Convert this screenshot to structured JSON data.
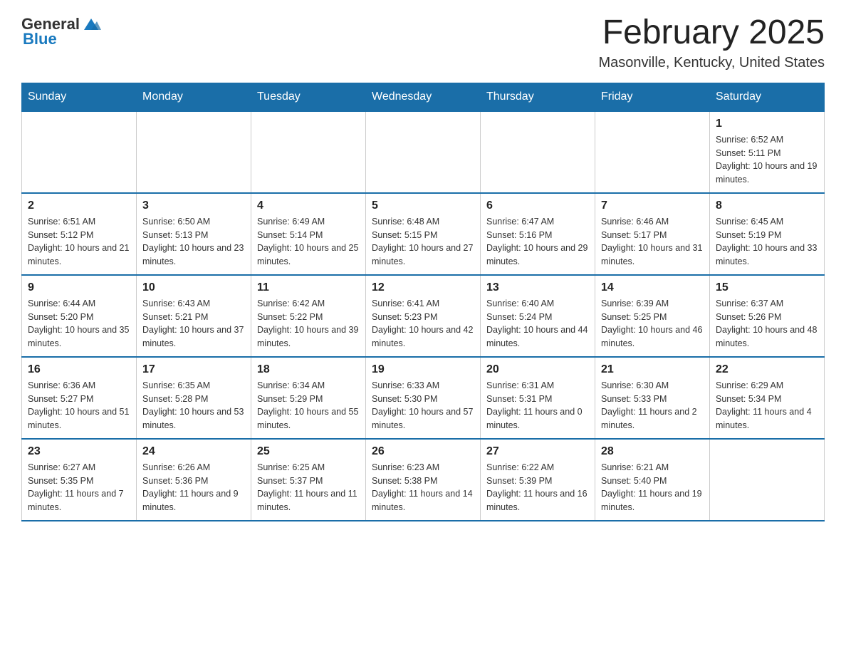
{
  "header": {
    "logo_general": "General",
    "logo_blue": "Blue",
    "title": "February 2025",
    "location": "Masonville, Kentucky, United States"
  },
  "weekdays": [
    "Sunday",
    "Monday",
    "Tuesday",
    "Wednesday",
    "Thursday",
    "Friday",
    "Saturday"
  ],
  "weeks": [
    [
      {
        "day": "",
        "info": ""
      },
      {
        "day": "",
        "info": ""
      },
      {
        "day": "",
        "info": ""
      },
      {
        "day": "",
        "info": ""
      },
      {
        "day": "",
        "info": ""
      },
      {
        "day": "",
        "info": ""
      },
      {
        "day": "1",
        "info": "Sunrise: 6:52 AM\nSunset: 5:11 PM\nDaylight: 10 hours and 19 minutes."
      }
    ],
    [
      {
        "day": "2",
        "info": "Sunrise: 6:51 AM\nSunset: 5:12 PM\nDaylight: 10 hours and 21 minutes."
      },
      {
        "day": "3",
        "info": "Sunrise: 6:50 AM\nSunset: 5:13 PM\nDaylight: 10 hours and 23 minutes."
      },
      {
        "day": "4",
        "info": "Sunrise: 6:49 AM\nSunset: 5:14 PM\nDaylight: 10 hours and 25 minutes."
      },
      {
        "day": "5",
        "info": "Sunrise: 6:48 AM\nSunset: 5:15 PM\nDaylight: 10 hours and 27 minutes."
      },
      {
        "day": "6",
        "info": "Sunrise: 6:47 AM\nSunset: 5:16 PM\nDaylight: 10 hours and 29 minutes."
      },
      {
        "day": "7",
        "info": "Sunrise: 6:46 AM\nSunset: 5:17 PM\nDaylight: 10 hours and 31 minutes."
      },
      {
        "day": "8",
        "info": "Sunrise: 6:45 AM\nSunset: 5:19 PM\nDaylight: 10 hours and 33 minutes."
      }
    ],
    [
      {
        "day": "9",
        "info": "Sunrise: 6:44 AM\nSunset: 5:20 PM\nDaylight: 10 hours and 35 minutes."
      },
      {
        "day": "10",
        "info": "Sunrise: 6:43 AM\nSunset: 5:21 PM\nDaylight: 10 hours and 37 minutes."
      },
      {
        "day": "11",
        "info": "Sunrise: 6:42 AM\nSunset: 5:22 PM\nDaylight: 10 hours and 39 minutes."
      },
      {
        "day": "12",
        "info": "Sunrise: 6:41 AM\nSunset: 5:23 PM\nDaylight: 10 hours and 42 minutes."
      },
      {
        "day": "13",
        "info": "Sunrise: 6:40 AM\nSunset: 5:24 PM\nDaylight: 10 hours and 44 minutes."
      },
      {
        "day": "14",
        "info": "Sunrise: 6:39 AM\nSunset: 5:25 PM\nDaylight: 10 hours and 46 minutes."
      },
      {
        "day": "15",
        "info": "Sunrise: 6:37 AM\nSunset: 5:26 PM\nDaylight: 10 hours and 48 minutes."
      }
    ],
    [
      {
        "day": "16",
        "info": "Sunrise: 6:36 AM\nSunset: 5:27 PM\nDaylight: 10 hours and 51 minutes."
      },
      {
        "day": "17",
        "info": "Sunrise: 6:35 AM\nSunset: 5:28 PM\nDaylight: 10 hours and 53 minutes."
      },
      {
        "day": "18",
        "info": "Sunrise: 6:34 AM\nSunset: 5:29 PM\nDaylight: 10 hours and 55 minutes."
      },
      {
        "day": "19",
        "info": "Sunrise: 6:33 AM\nSunset: 5:30 PM\nDaylight: 10 hours and 57 minutes."
      },
      {
        "day": "20",
        "info": "Sunrise: 6:31 AM\nSunset: 5:31 PM\nDaylight: 11 hours and 0 minutes."
      },
      {
        "day": "21",
        "info": "Sunrise: 6:30 AM\nSunset: 5:33 PM\nDaylight: 11 hours and 2 minutes."
      },
      {
        "day": "22",
        "info": "Sunrise: 6:29 AM\nSunset: 5:34 PM\nDaylight: 11 hours and 4 minutes."
      }
    ],
    [
      {
        "day": "23",
        "info": "Sunrise: 6:27 AM\nSunset: 5:35 PM\nDaylight: 11 hours and 7 minutes."
      },
      {
        "day": "24",
        "info": "Sunrise: 6:26 AM\nSunset: 5:36 PM\nDaylight: 11 hours and 9 minutes."
      },
      {
        "day": "25",
        "info": "Sunrise: 6:25 AM\nSunset: 5:37 PM\nDaylight: 11 hours and 11 minutes."
      },
      {
        "day": "26",
        "info": "Sunrise: 6:23 AM\nSunset: 5:38 PM\nDaylight: 11 hours and 14 minutes."
      },
      {
        "day": "27",
        "info": "Sunrise: 6:22 AM\nSunset: 5:39 PM\nDaylight: 11 hours and 16 minutes."
      },
      {
        "day": "28",
        "info": "Sunrise: 6:21 AM\nSunset: 5:40 PM\nDaylight: 11 hours and 19 minutes."
      },
      {
        "day": "",
        "info": ""
      }
    ]
  ]
}
